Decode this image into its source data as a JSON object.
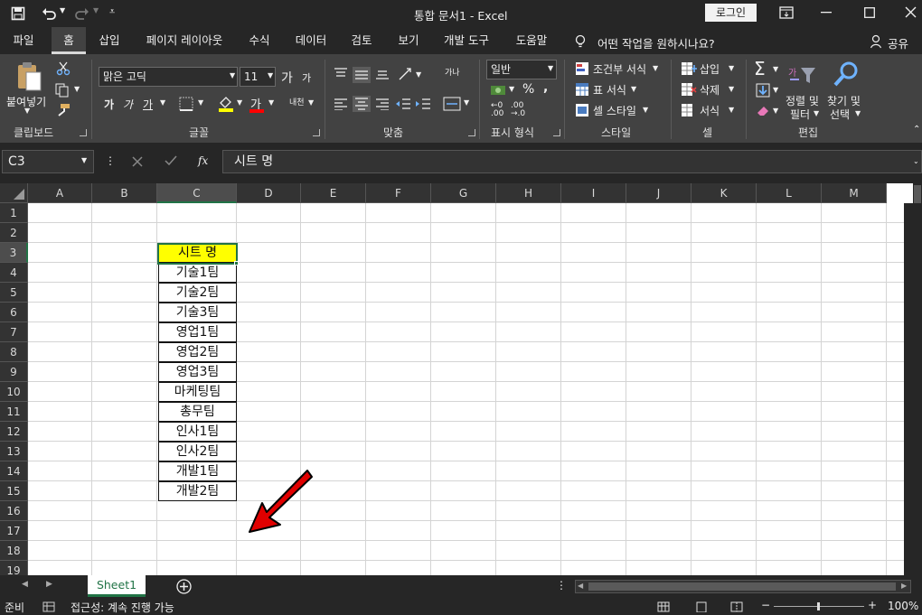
{
  "title": {
    "text": "통합 문서1  -  Excel",
    "login": "로그인"
  },
  "tabs": [
    "파일",
    "홈",
    "삽입",
    "페이지 레이아웃",
    "수식",
    "데이터",
    "검토",
    "보기",
    "개발 도구",
    "도움말"
  ],
  "tell_me": "어떤 작업을 원하시나요?",
  "share": "공유",
  "ribbon": {
    "clipboard": {
      "paste": "붙여넣기",
      "label": "클립보드"
    },
    "font": {
      "name": "맑은 고딕",
      "size": "11",
      "grow": "가",
      "shrink": "가",
      "bold": "가",
      "italic": "가",
      "underline": "가",
      "color_char": "가",
      "phonetic": "내천",
      "label": "글꼴"
    },
    "alignment": {
      "wrap": "가나",
      "label": "맞춤"
    },
    "number": {
      "format": "일반",
      "label": "표시 형식"
    },
    "styles": {
      "conditional": "조건부 서식",
      "table": "표 서식",
      "cell": "셀 스타일",
      "label": "스타일"
    },
    "cells": {
      "insert": "삽입",
      "delete": "삭제",
      "format": "서식",
      "label": "셀"
    },
    "editing": {
      "sort1": "정렬 및",
      "sort2": "필터",
      "find1": "찾기 및",
      "find2": "선택",
      "label": "편집"
    }
  },
  "formula_bar": {
    "name_box": "C3",
    "fx": "fx",
    "value": "시트 명"
  },
  "columns": [
    "A",
    "B",
    "C",
    "D",
    "E",
    "F",
    "G",
    "H",
    "I",
    "J",
    "K",
    "L",
    "M"
  ],
  "rows": [
    "1",
    "2",
    "3",
    "4",
    "5",
    "6",
    "7",
    "8",
    "9",
    "10",
    "11",
    "12",
    "13",
    "14",
    "15",
    "16",
    "17",
    "18",
    "19"
  ],
  "cells_C": [
    "시트 명",
    "기술1팀",
    "기술2팀",
    "기술3팀",
    "영업1팀",
    "영업2팀",
    "영업3팀",
    "마케팅팀",
    "총무팀",
    "인사1팀",
    "인사2팀",
    "개발1팀",
    "개발2팀"
  ],
  "sheet_tab": "Sheet1",
  "status": {
    "ready": "준비",
    "accessibility": "접근성: 계속 진행 가능",
    "zoom": "100%"
  },
  "colors": {
    "header_fill": "#ffff00",
    "arrow": "#e00000",
    "selected": "#217346"
  }
}
